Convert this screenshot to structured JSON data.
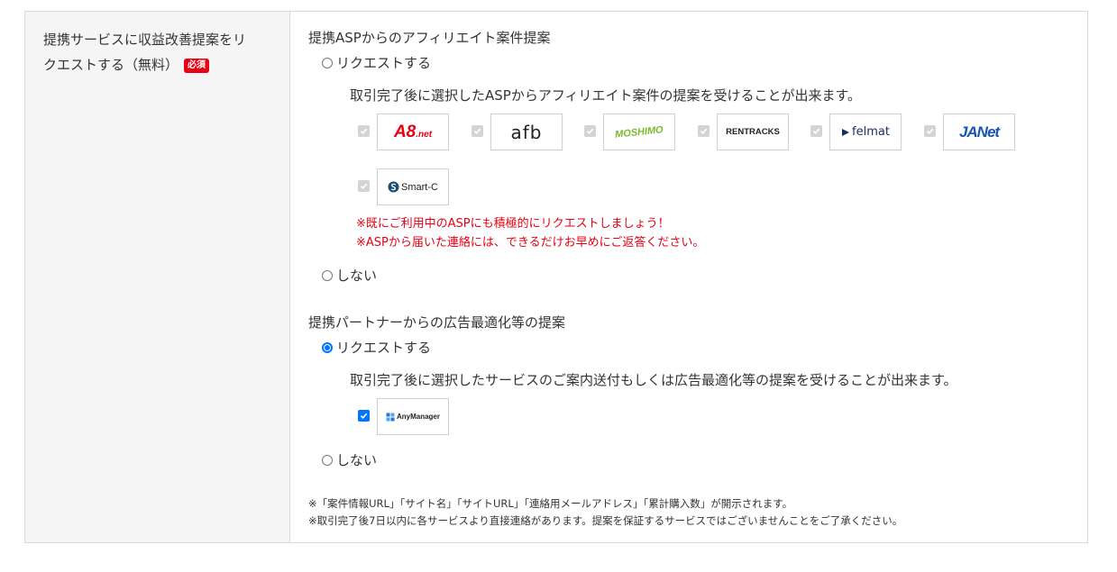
{
  "row_label": {
    "line1": "提携サービスに収益改善提案をリ",
    "line2": "クエストする（無料）",
    "badge": "必須"
  },
  "asp_section": {
    "title": "提携ASPからのアフィリエイト案件提案",
    "option_request": "リクエストする",
    "description": "取引完了後に選択したASPからアフィリエイト案件の提案を受けることが出来ます。",
    "logos": [
      {
        "name": "A8.net",
        "text": "A8",
        "sub": ".net",
        "checked": true
      },
      {
        "name": "afb",
        "text": "afb",
        "checked": true
      },
      {
        "name": "MOSHIMO",
        "text": "MOSHIMO",
        "checked": true
      },
      {
        "name": "RENTRACKS",
        "text": "RENTRACKS",
        "checked": true
      },
      {
        "name": "felmat",
        "text": "felmat",
        "checked": true
      },
      {
        "name": "JANet",
        "text": "JANet",
        "checked": true
      },
      {
        "name": "Smart-C",
        "text": "Smart-C",
        "checked": true
      }
    ],
    "notice1": "※既にご利用中のASPにも積極的にリクエストしましょう！",
    "notice2": "※ASPから届いた連絡には、できるだけお早めにご返答ください。",
    "option_decline": "しない"
  },
  "partner_section": {
    "title": "提携パートナーからの広告最適化等の提案",
    "option_request": "リクエストする",
    "description": "取引完了後に選択したサービスのご案内送付もしくは広告最適化等の提案を受けることが出来ます。",
    "logos": [
      {
        "name": "AnyManager",
        "text": "AnyManager",
        "checked": true
      }
    ],
    "option_decline": "しない"
  },
  "footnotes": {
    "line1": "※「案件情報URL」「サイト名」「サイトURL」「連絡用メールアドレス」「累計購入数」が開示されます。",
    "line2": "※取引完了後7日以内に各サービスより直接連絡があります。提案を保証するサービスではございませんことをご了承ください。"
  },
  "colors": {
    "required_badge": "#e60012",
    "notice_text": "#e60012",
    "radio_checked": "#0075ff",
    "label_bg": "#f5f5f5",
    "border": "#d9d9d9"
  }
}
